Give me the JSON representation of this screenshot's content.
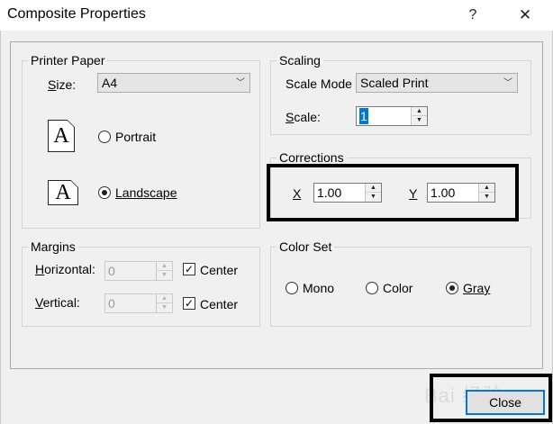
{
  "window": {
    "title": "Composite Properties",
    "help_glyph": "?",
    "close_glyph": "✕"
  },
  "printer_paper": {
    "legend": "Printer Paper",
    "size_label": "Size:",
    "size_value": "A4",
    "portrait_label": "Portrait",
    "landscape_label": "Landscape",
    "portrait_icon_letter": "A",
    "landscape_icon_letter": "A",
    "selected": "Landscape"
  },
  "scaling": {
    "legend": "Scaling",
    "scale_mode_label": "Scale Mode",
    "scale_mode_value": "Scaled Print",
    "scale_label": "Scale:",
    "scale_value": "1"
  },
  "corrections": {
    "legend": "Corrections",
    "x_label": "X",
    "x_value": "1.00",
    "y_label": "Y",
    "y_value": "1.00"
  },
  "margins": {
    "legend": "Margins",
    "horizontal_label": "Horizontal:",
    "horizontal_value": "0",
    "vertical_label": "Vertical:",
    "vertical_value": "0",
    "center_label_1": "Center",
    "center_label_2": "Center"
  },
  "color_set": {
    "legend": "Color Set",
    "options": [
      "Mono",
      "Color",
      "Gray"
    ],
    "selected": "Gray"
  },
  "buttons": {
    "close_label": "Close"
  },
  "watermark": "Bai 经验",
  "icons": {
    "up": "▲",
    "down": "▼",
    "chevron": "﹀",
    "check": "✓"
  },
  "colors": {
    "focus_blue": "#0078d7",
    "dialog_bg": "#f0f0f0"
  }
}
